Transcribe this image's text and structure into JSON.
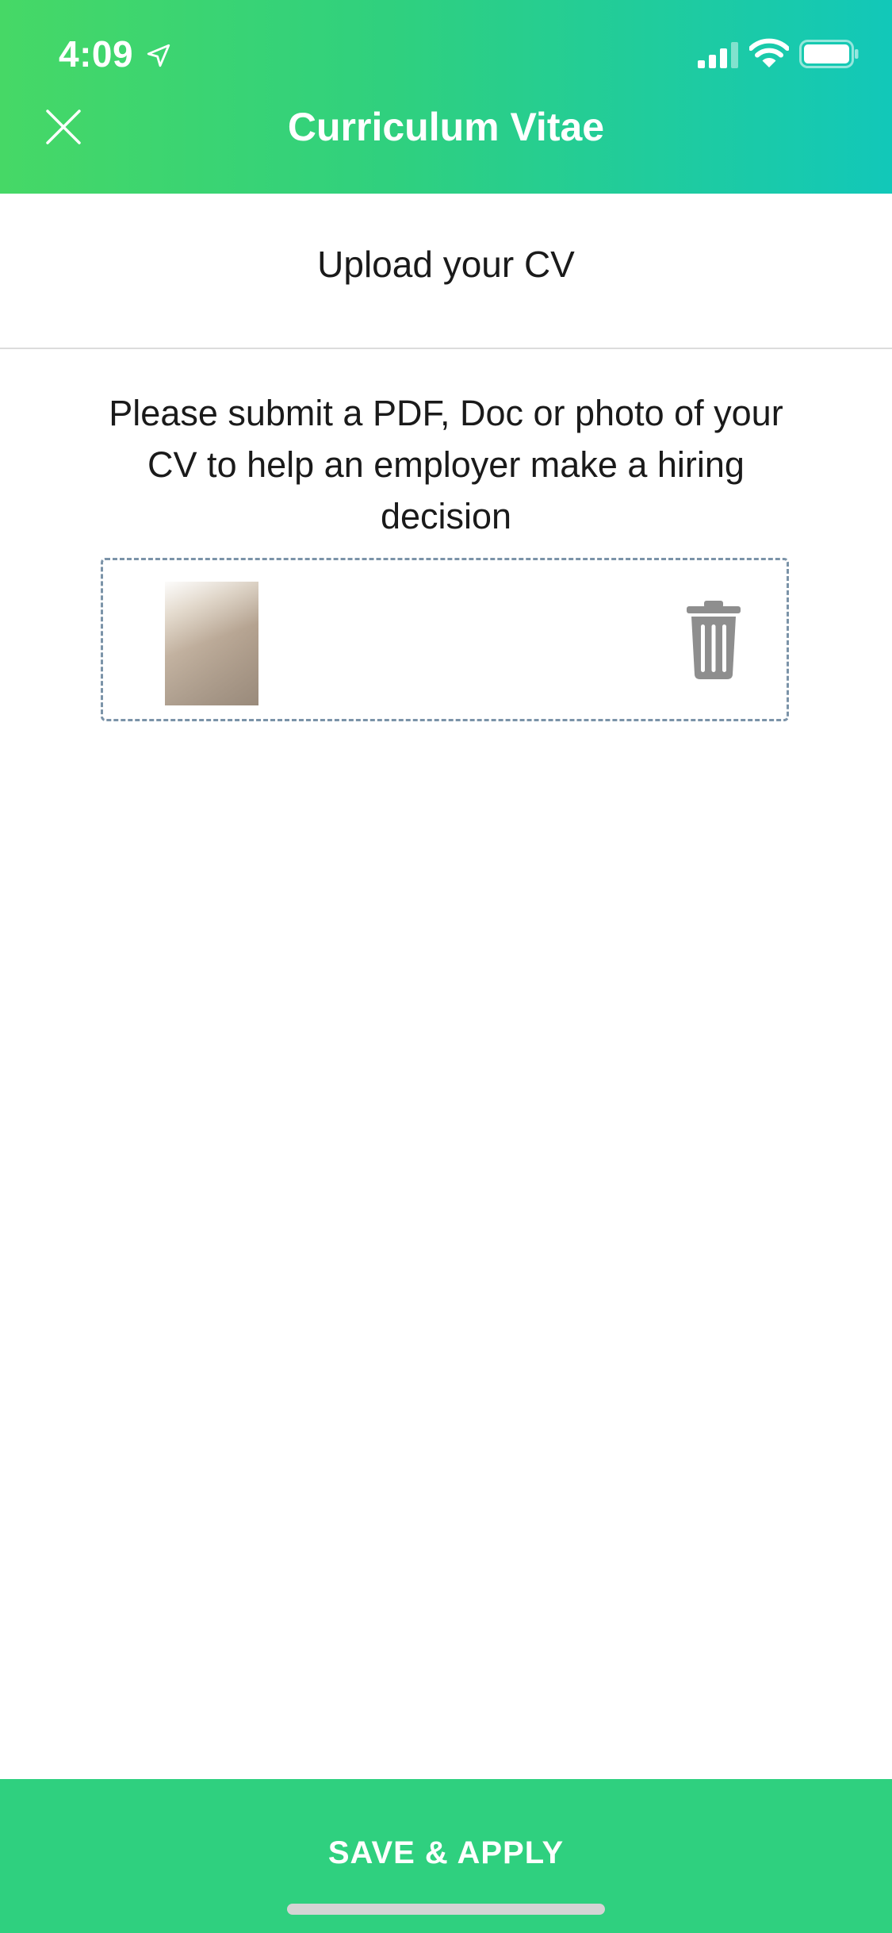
{
  "status_bar": {
    "time": "4:09",
    "icons": [
      "location-arrow-icon",
      "cellular-signal-icon",
      "wifi-icon",
      "battery-icon"
    ]
  },
  "nav": {
    "title": "Curriculum Vitae",
    "close_icon": "close-icon"
  },
  "upload": {
    "title": "Upload your CV",
    "instructions": "Please submit a PDF, Doc or photo of your CV to help an employer make a hiring decision",
    "delete_icon": "trash-icon"
  },
  "action": {
    "label": "SAVE & APPLY"
  },
  "colors": {
    "header_gradient_start": "#46d866",
    "header_gradient_end": "#12c8b9",
    "action_button": "#2fd07f",
    "dashed_border": "#7b93a8",
    "trash_icon": "#8e8e8e"
  }
}
